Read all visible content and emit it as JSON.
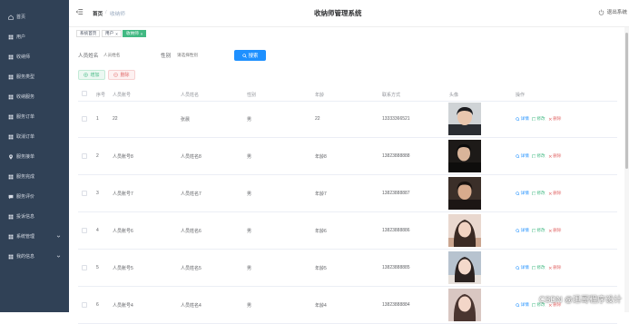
{
  "sidebar": {
    "items": [
      {
        "label": "首页",
        "icon": "home-icon"
      },
      {
        "label": "用户",
        "icon": "grid-icon"
      },
      {
        "label": "收纳师",
        "icon": "grid-icon"
      },
      {
        "label": "服务类型",
        "icon": "grid-icon"
      },
      {
        "label": "收纳服务",
        "icon": "grid-icon"
      },
      {
        "label": "服务订单",
        "icon": "grid-icon"
      },
      {
        "label": "取消订单",
        "icon": "grid-icon"
      },
      {
        "label": "服务接单",
        "icon": "pin-icon"
      },
      {
        "label": "服务完成",
        "icon": "grid-icon"
      },
      {
        "label": "服务评价",
        "icon": "chat-icon"
      },
      {
        "label": "投诉信息",
        "icon": "grid-icon"
      },
      {
        "label": "系统管理",
        "icon": "grid-icon"
      },
      {
        "label": "我的信息",
        "icon": "grid-icon"
      }
    ]
  },
  "header": {
    "breadcrumb_home": "首页",
    "breadcrumb_sep": "/",
    "breadcrumb_current": "收纳师",
    "title": "收纳师管理系统",
    "logout_label": "退出系统"
  },
  "tags": {
    "items": [
      "系统首页",
      "用户",
      "收纳师"
    ]
  },
  "search": {
    "name_label": "人员姓名",
    "name_placeholder": "人员姓名",
    "gender_label": "性别",
    "gender_placeholder": "请选择性别",
    "button_label": "搜索"
  },
  "ops": {
    "add_label": "增加",
    "delete_label": "删除"
  },
  "table": {
    "headers": {
      "index": "序号",
      "account": "人员账号",
      "name": "人员姓名",
      "gender": "性别",
      "age": "年龄",
      "phone": "联系方式",
      "avatar": "头像",
      "actions": "操作"
    },
    "action_labels": {
      "detail": "详情",
      "edit": "修改",
      "remove": "删除"
    },
    "rows": [
      {
        "index": "1",
        "account": "22",
        "name": "张晨",
        "gender": "男",
        "age": "22",
        "phone": "13333366521"
      },
      {
        "index": "2",
        "account": "人员账号8",
        "name": "人员姓名8",
        "gender": "男",
        "age": "年龄8",
        "phone": "13823888888"
      },
      {
        "index": "3",
        "account": "人员账号7",
        "name": "人员姓名7",
        "gender": "男",
        "age": "年龄7",
        "phone": "13823888887"
      },
      {
        "index": "4",
        "account": "人员账号6",
        "name": "人员姓名6",
        "gender": "男",
        "age": "年龄6",
        "phone": "13823888886"
      },
      {
        "index": "5",
        "account": "人员账号5",
        "name": "人员姓名5",
        "gender": "男",
        "age": "年龄5",
        "phone": "13823888885"
      },
      {
        "index": "6",
        "account": "人员账号4",
        "name": "人员姓名4",
        "gender": "男",
        "age": "年龄4",
        "phone": "13823888884"
      }
    ]
  },
  "watermark": "CSDN @迅哥程序设计",
  "colors": {
    "sidebar_bg": "#304156",
    "accent_green": "#42b983",
    "accent_blue": "#1e90ff",
    "danger": "#e26c6c"
  }
}
